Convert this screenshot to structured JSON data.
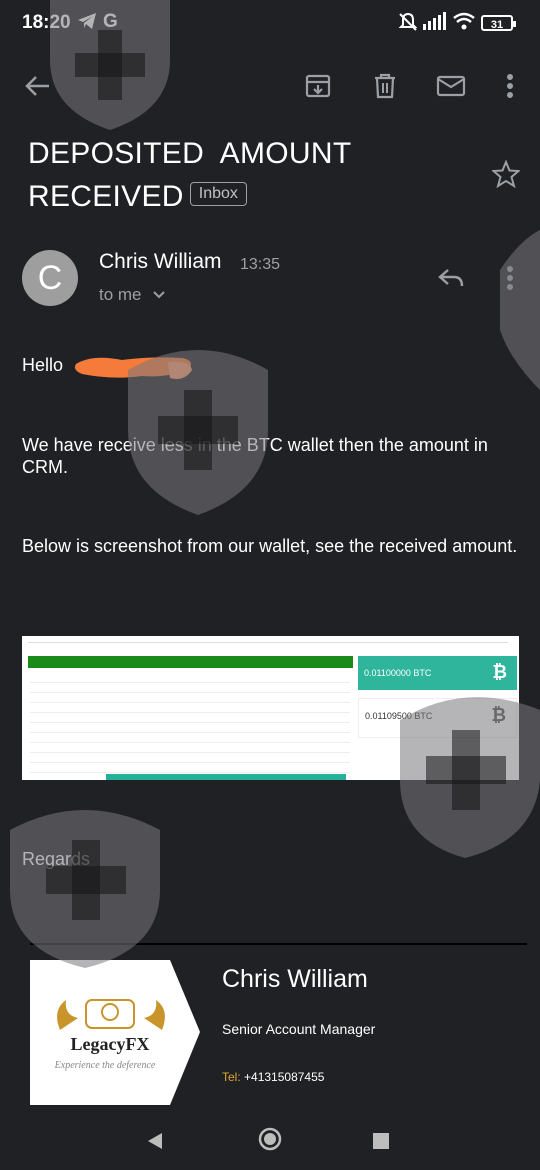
{
  "status_bar": {
    "time": "18:20",
    "battery": "31"
  },
  "toolbar": {
    "back_icon": "arrow-left-icon",
    "archive_icon": "archive-icon",
    "delete_icon": "trash-icon",
    "mark_unread_icon": "mail-icon",
    "more_icon": "more-vert-icon"
  },
  "email": {
    "subject_line1": "DEPOSITED  AMOUNT",
    "subject_line2": "RECEIVED",
    "label_chip": "Inbox",
    "sender_initial": "C",
    "sender_name": "Chris William",
    "time": "13:35",
    "recipient": "to me",
    "greeting": "Hello",
    "paragraph1": "We have receive less in the BTC wallet then the amount in CRM.",
    "paragraph2": "Below is screenshot from our wallet, see the received amount.",
    "closing": "Regards"
  },
  "embedded_screenshot": {
    "received_amount": "0.01100000 BTC",
    "requested_amount": "0.01109500 BTC"
  },
  "signature": {
    "name": "Chris William",
    "role": "Senior Account Manager",
    "tel_label": "Tel:",
    "tel_value": "+41315087455",
    "logo_text": "LegacyFX",
    "logo_tagline": "Experience the deference"
  },
  "colors": {
    "background": "#202124",
    "accent_teal": "#2fb59b",
    "green_bar": "#1a8a1a",
    "redaction": "#f47b3a"
  }
}
